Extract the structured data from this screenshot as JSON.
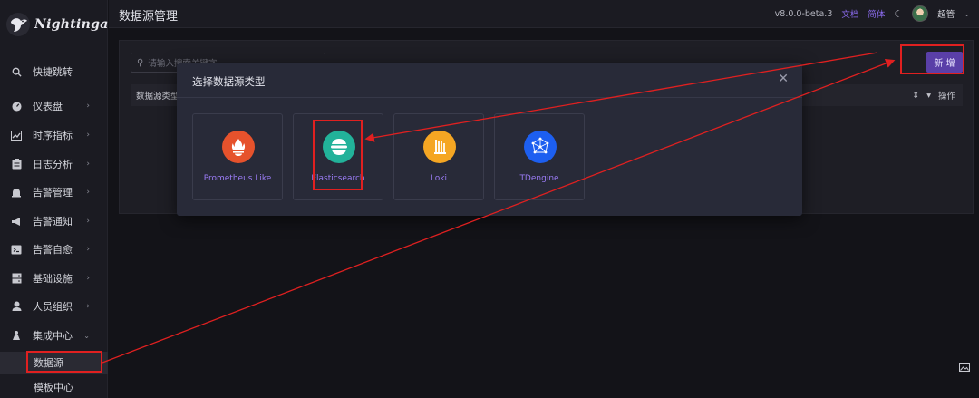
{
  "app": {
    "logo_text": "Nightingale"
  },
  "header": {
    "title": "数据源管理",
    "version": "v8.0.0-beta.3",
    "docs_link": "文档",
    "lang_link": "简体",
    "user": "超管"
  },
  "sidebar": {
    "items": [
      {
        "label": "快捷跳转",
        "icon": "search-icon",
        "chevron": false
      },
      {
        "label": "仪表盘",
        "icon": "dashboard-icon",
        "chevron": true
      },
      {
        "label": "时序指标",
        "icon": "line-chart-icon",
        "chevron": true
      },
      {
        "label": "日志分析",
        "icon": "log-icon",
        "chevron": true
      },
      {
        "label": "告警管理",
        "icon": "alarm-bell-icon",
        "chevron": true
      },
      {
        "label": "告警通知",
        "icon": "megaphone-icon",
        "chevron": true
      },
      {
        "label": "告警自愈",
        "icon": "terminal-icon",
        "chevron": true
      },
      {
        "label": "基础设施",
        "icon": "server-icon",
        "chevron": true
      },
      {
        "label": "人员组织",
        "icon": "user-icon",
        "chevron": true
      },
      {
        "label": "集成中心",
        "icon": "integration-icon",
        "chevron": true,
        "expanded": true
      }
    ],
    "sub_items": [
      {
        "label": "数据源",
        "active": true
      },
      {
        "label": "模板中心",
        "active": false
      }
    ]
  },
  "main": {
    "search_placeholder": "请输入搜索关键字",
    "new_button": "新 增",
    "table_col_type": "数据源类型",
    "table_col_actions": "操作"
  },
  "modal": {
    "title": "选择数据源类型",
    "cards": [
      {
        "label": "Prometheus Like",
        "icon": "prometheus-icon",
        "color": "#e6522c"
      },
      {
        "label": "Elasticsearch",
        "icon": "elasticsearch-icon",
        "color": "#22b29a"
      },
      {
        "label": "Loki",
        "icon": "loki-icon",
        "color": "#f5a623"
      },
      {
        "label": "TDengine",
        "icon": "tdengine-icon",
        "color": "#1d5ff0"
      }
    ]
  },
  "colors": {
    "accent": "#5a3fa8",
    "annotation_red": "#e02020",
    "link": "#8c6cf0"
  }
}
